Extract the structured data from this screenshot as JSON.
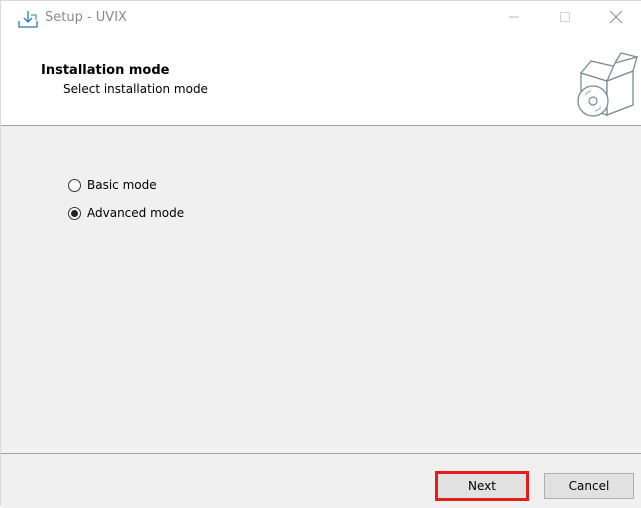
{
  "window": {
    "title": "Setup - UVIX"
  },
  "header": {
    "title": "Installation mode",
    "subtitle": "Select installation mode",
    "icon": "software-box-disc-icon"
  },
  "options": [
    {
      "label": "Basic mode",
      "selected": false
    },
    {
      "label": "Advanced mode",
      "selected": true
    }
  ],
  "buttons": {
    "next_label": "Next",
    "cancel_label": "Cancel",
    "highlight_color": "#e31c1c"
  }
}
